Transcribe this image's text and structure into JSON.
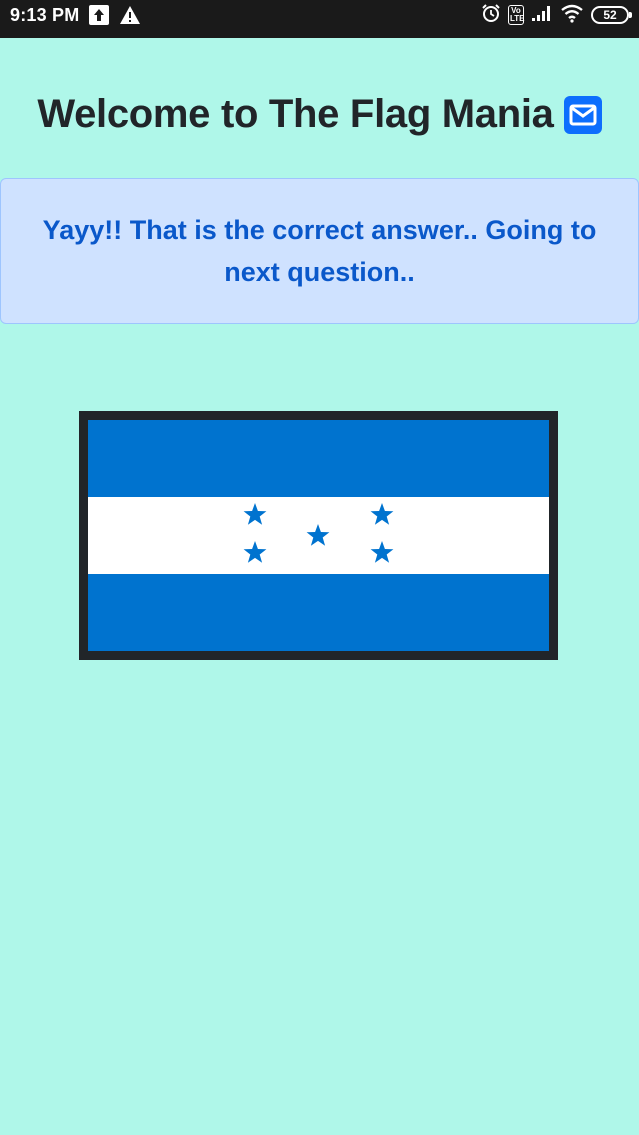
{
  "status_bar": {
    "time": "9:13 PM",
    "battery_level": "52",
    "volte_label": "Vo LTE",
    "icons": [
      "upload-icon",
      "warning-icon",
      "alarm-icon",
      "volte-icon",
      "signal-icon",
      "wifi-icon",
      "battery-icon"
    ]
  },
  "header": {
    "title": "Welcome to The Flag Mania",
    "icon": "mail-icon"
  },
  "alert": {
    "message": "Yayy!! That is the correct answer.. Going to next question.."
  },
  "flag": {
    "colors": {
      "stripe": "#0073cf",
      "middle": "#ffffff",
      "star": "#0073cf",
      "frame": "#212529"
    },
    "star_count": 5
  },
  "theme": {
    "background": "#aff7e9",
    "alert_background": "#cfe2ff",
    "alert_text": "#0a58ca",
    "title_text": "#212529",
    "accent": "#0d6efd"
  }
}
